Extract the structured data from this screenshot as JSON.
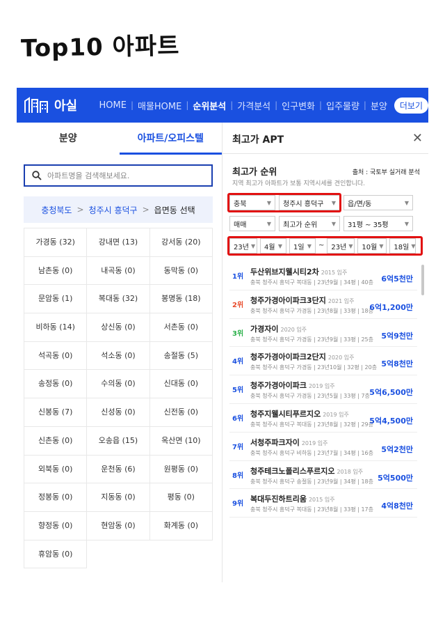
{
  "heading": "Top10 아파트",
  "nav": {
    "logo_text": "아실",
    "items": [
      {
        "label": "HOME",
        "active": false
      },
      {
        "label": "매물HOME",
        "active": false
      },
      {
        "label": "순위분석",
        "active": true
      },
      {
        "label": "가격분석",
        "active": false
      },
      {
        "label": "인구변화",
        "active": false
      },
      {
        "label": "입주물량",
        "active": false
      },
      {
        "label": "분양",
        "active": false
      }
    ],
    "more_label": "더보기",
    "color_bg": "#1a50e0"
  },
  "left": {
    "tabs": [
      {
        "label": "분양",
        "active": false
      },
      {
        "label": "아파트/오피스텔",
        "active": true
      }
    ],
    "search_placeholder": "아파트명을 검색해보세요.",
    "breadcrumb": [
      "충청북도",
      "청주시 흥덕구",
      "읍면동 선택"
    ],
    "dongs": [
      "가경동 (32)",
      "강내면 (13)",
      "강서동 (20)",
      "남촌동 (0)",
      "내곡동 (0)",
      "동막동 (0)",
      "문암동 (1)",
      "복대동 (32)",
      "봉명동 (18)",
      "비하동 (14)",
      "상신동 (0)",
      "서촌동 (0)",
      "석곡동 (0)",
      "석소동 (0)",
      "송절동 (5)",
      "송정동 (0)",
      "수의동 (0)",
      "신대동 (0)",
      "신봉동 (7)",
      "신성동 (0)",
      "신전동 (0)",
      "신촌동 (0)",
      "오송읍 (15)",
      "옥산면 (10)",
      "외북동 (0)",
      "운천동 (6)",
      "원평동 (0)",
      "정봉동 (0)",
      "지동동 (0)",
      "평동 (0)",
      "향정동 (0)",
      "현암동 (0)",
      "화계동 (0)",
      "휴암동 (0)"
    ]
  },
  "right": {
    "panel_title": "최고가 APT",
    "section_title": "최고가 순위",
    "source": "출처 : 국토부 실거래 분석",
    "description": "지역 최고가 아파트가 보통 지역시세를 견인합니다.",
    "filters": {
      "row1": [
        "충북",
        "청주시 흥덕구",
        "읍/면/동"
      ],
      "row2": [
        "매매",
        "최고가 순위",
        "31평 ~ 35평"
      ],
      "row3": [
        "23년",
        "4월",
        "1일",
        "~",
        "23년",
        "10월",
        "18일"
      ]
    },
    "rankings": [
      {
        "rank": "1위",
        "name": "두산위브지웰시티2차",
        "year": "2015 입주",
        "meta": "충북 청주시 흥덕구 복대동 | 23년9월 | 34평 | 40층",
        "price": "6억5천만",
        "rank_color": "#1a50e0"
      },
      {
        "rank": "2위",
        "name": "청주가경아이파크3단지",
        "year": "2021 입주",
        "meta": "충북 청주시 흥덕구 가경동 | 23년8월 | 33평 | 18층",
        "price": "6억1,200만",
        "rank_color": "#e84a2a"
      },
      {
        "rank": "3위",
        "name": "가경자이",
        "year": "2020 입주",
        "meta": "충북 청주시 흥덕구 가경동 | 23년9월 | 33평 | 25층",
        "price": "5억9천만",
        "rank_color": "#2bb04a"
      },
      {
        "rank": "4위",
        "name": "청주가경아이파크2단지",
        "year": "2020 입주",
        "meta": "충북 청주시 흥덕구 가경동 | 23년10월 | 32평 | 20층",
        "price": "5억8천만",
        "rank_color": "#1a50e0"
      },
      {
        "rank": "5위",
        "name": "청주가경아이파크",
        "year": "2019 입주",
        "meta": "충북 청주시 흥덕구 가경동 | 23년5월 | 33평 | 7층",
        "price": "5억6,500만",
        "rank_color": "#1a50e0"
      },
      {
        "rank": "6위",
        "name": "청주지웰시티푸르지오",
        "year": "2019 입주",
        "meta": "충북 청주시 흥덕구 복대동 | 23년8월 | 32평 | 29층",
        "price": "5억4,500만",
        "rank_color": "#1a50e0"
      },
      {
        "rank": "7위",
        "name": "서청주파크자이",
        "year": "2019 입주",
        "meta": "충북 청주시 흥덕구 비하동 | 23년7월 | 34평 | 16층",
        "price": "5억2천만",
        "rank_color": "#1a50e0"
      },
      {
        "rank": "8위",
        "name": "청주테크노폴리스푸르지오",
        "year": "2018 입주",
        "meta": "충북 청주시 흥덕구 송절동 | 23년9월 | 34평 | 18층",
        "price": "5억500만",
        "rank_color": "#1a50e0"
      },
      {
        "rank": "9위",
        "name": "복대두진하트리움",
        "year": "2015 입주",
        "meta": "충북 청주시 흥덕구 복대동 | 23년8월 | 33평 | 17층",
        "price": "4억8천만",
        "rank_color": "#1a50e0"
      }
    ]
  }
}
